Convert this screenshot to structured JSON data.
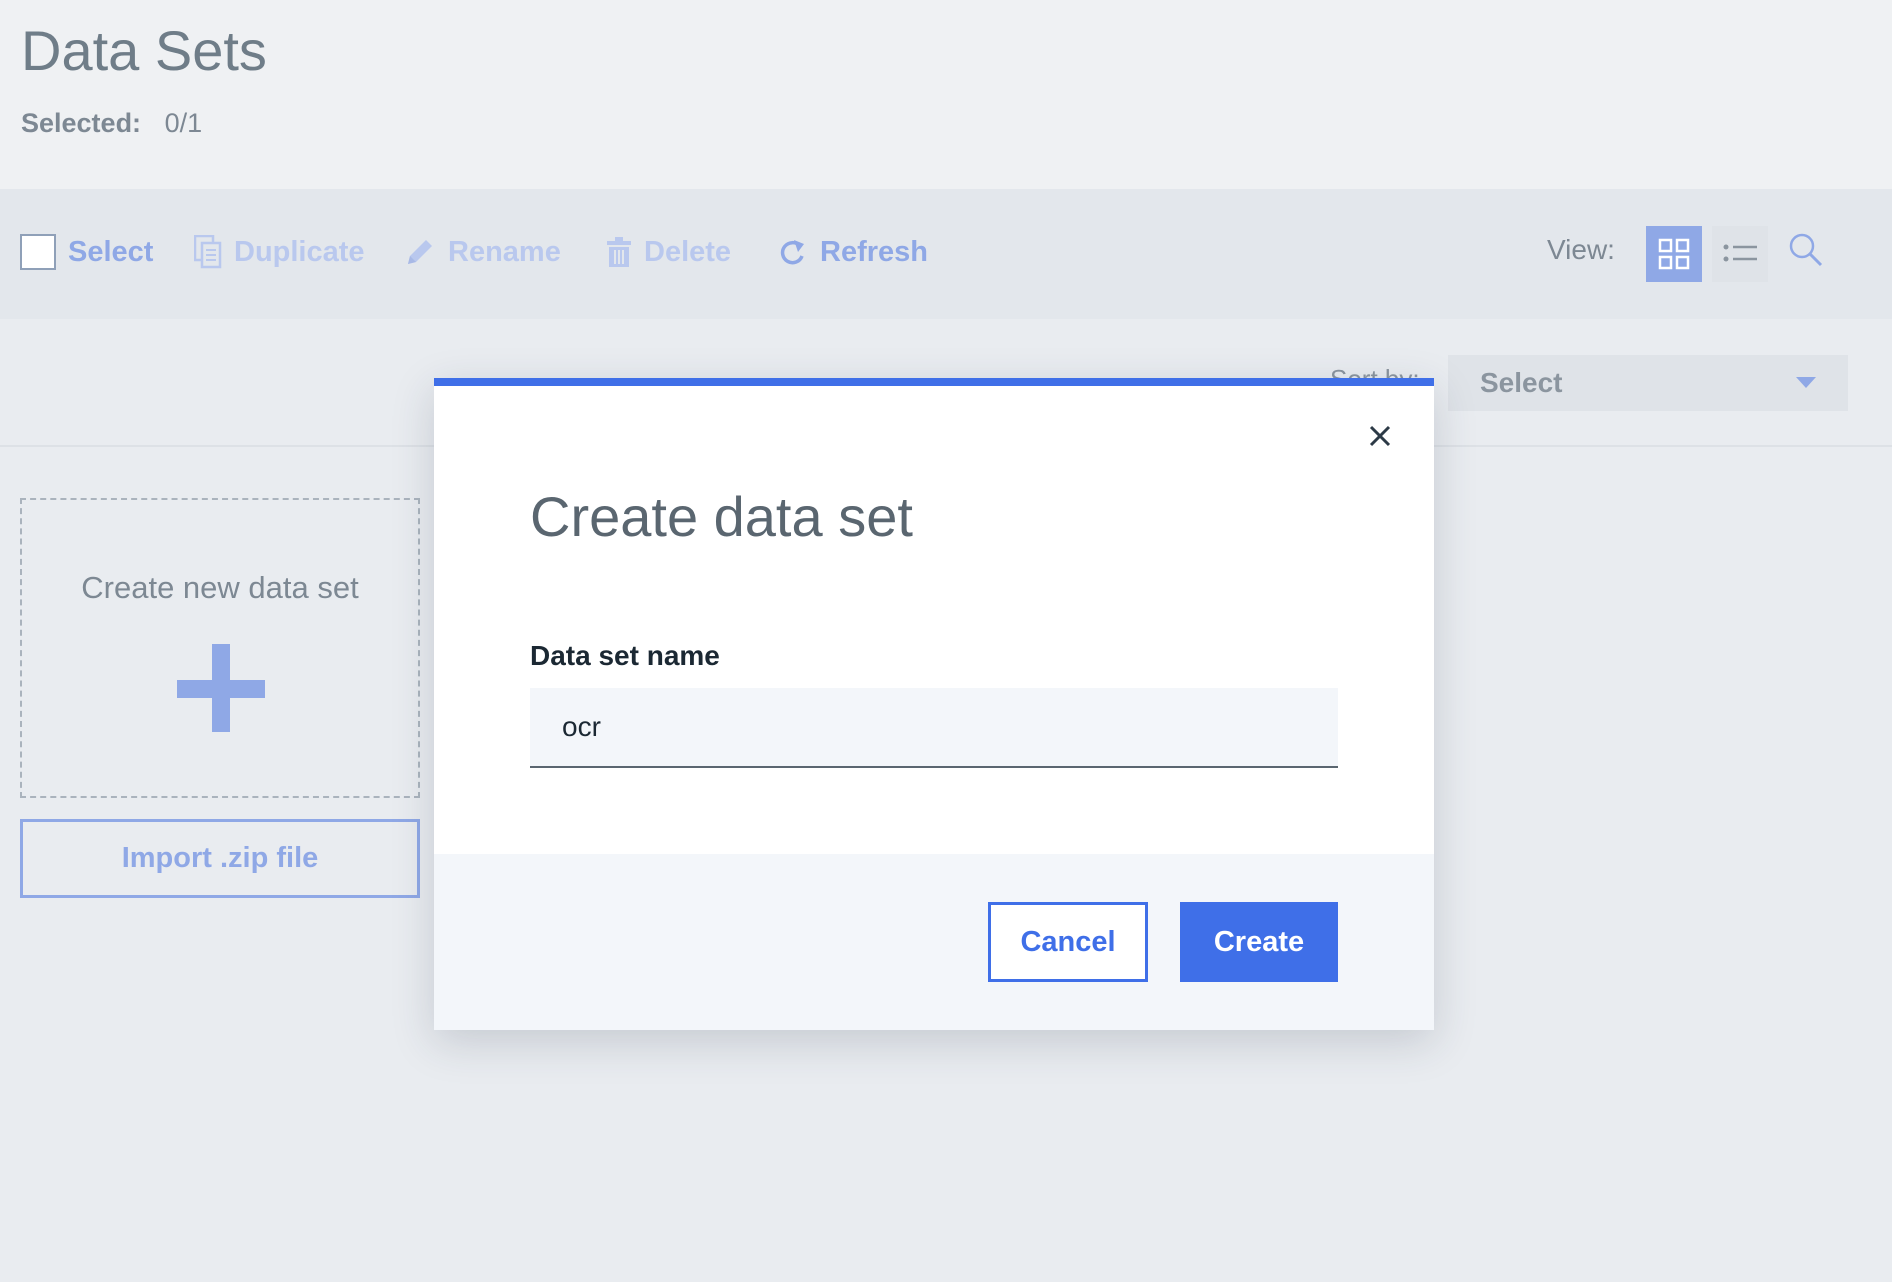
{
  "page": {
    "title": "Data Sets",
    "selected_label": "Selected:",
    "selected_value": "0/1"
  },
  "toolbar": {
    "select": "Select",
    "duplicate": "Duplicate",
    "rename": "Rename",
    "delete": "Delete",
    "refresh": "Refresh",
    "view_label": "View:"
  },
  "sort": {
    "label": "Sort by:",
    "value": "Select"
  },
  "cards": {
    "create_new": "Create new data set",
    "import": "Import .zip file"
  },
  "modal": {
    "title": "Create data set",
    "field_label": "Data set name",
    "field_value": "ocr",
    "cancel": "Cancel",
    "create": "Create"
  },
  "colors": {
    "accent": "#3f6fe8",
    "accent_light": "#8fa8e6",
    "disabled": "#b9c8ee"
  }
}
